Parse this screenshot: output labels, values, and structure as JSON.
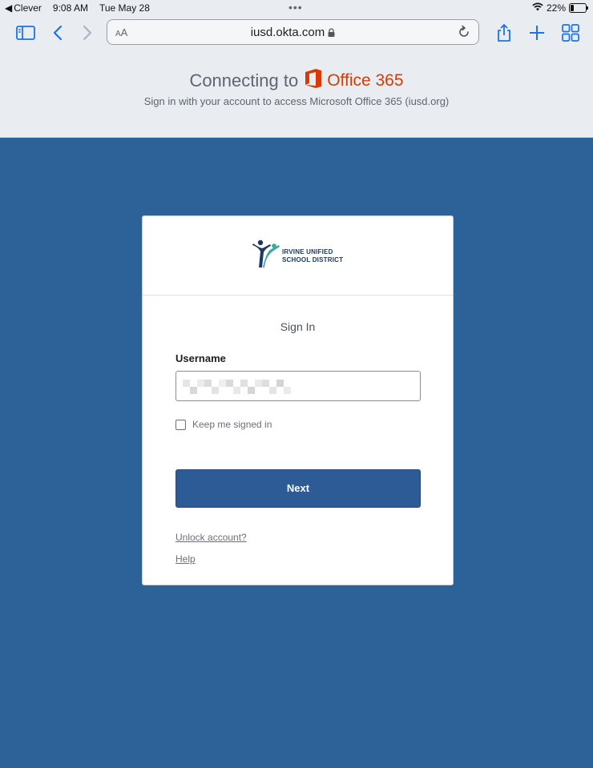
{
  "status_bar": {
    "back_app": "Clever",
    "time": "9:08 AM",
    "date": "Tue May 28",
    "battery_percent": "22%",
    "battery_level": 0.22
  },
  "browser": {
    "aa_label_small": "A",
    "aa_label_large": "A",
    "url": "iusd.okta.com",
    "icons": [
      "sidebar-icon",
      "back-icon",
      "forward-icon",
      "lock-icon",
      "reload-icon",
      "share-icon",
      "new-tab-icon",
      "tabs-icon"
    ]
  },
  "okta_header": {
    "connecting_to": "Connecting to",
    "app_name": "Office 365",
    "subtitle": "Sign in with your account to access Microsoft Office 365 (iusd.org)"
  },
  "card": {
    "logo_line1": "IRVINE UNIFIED",
    "logo_line2": "SCHOOL DISTRICT",
    "title": "Sign In",
    "username_label": "Username",
    "keep_signed_in": "Keep me signed in",
    "next_label": "Next",
    "unlock_link": "Unlock account?",
    "help_link": "Help"
  },
  "colors": {
    "page_background": "#2c6298",
    "header_background": "#e9edf2",
    "primary_button": "#2c5b95",
    "office_orange": "#d83b01",
    "link_blue": "#1a73e8"
  }
}
